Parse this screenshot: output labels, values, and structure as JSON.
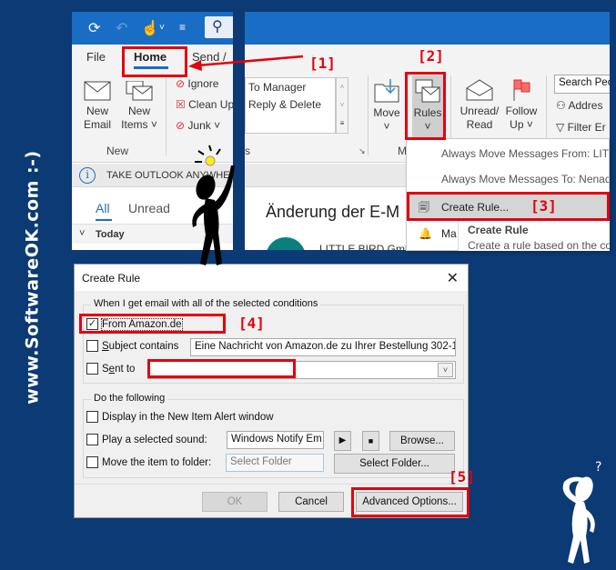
{
  "watermark": "www.SoftwareOK.com :-)",
  "outlook": {
    "tabs": {
      "file": "File",
      "home": "Home",
      "send": "Send /"
    },
    "new_group": {
      "new_email_l1": "New",
      "new_email_l2": "Email",
      "new_items_l1": "New",
      "new_items_l2": "Items ˅",
      "label": "New"
    },
    "delete_group": {
      "ignore": "Ignore",
      "clean_up": "Clean Up",
      "junk": "Junk ˅"
    },
    "quick_steps": {
      "item1": "To Manager",
      "item2": "Reply & Delete",
      "label": "s"
    },
    "move_group": {
      "move": "Move",
      "move_arrow": "˅",
      "rules": "Rules",
      "rules_arrow": "˅",
      "label": "Mo"
    },
    "tags_group": {
      "unread_l1": "Unread/",
      "unread_l2": "Read",
      "follow_l1": "Follow",
      "follow_l2": "Up ˅"
    },
    "find_group": {
      "search_people": "Search Peo",
      "address_book": "Addres",
      "filter_email": "Filter Er"
    },
    "infobar": "TAKE OUTLOOK ANYWHE",
    "mail_tabs": {
      "all": "All",
      "unread": "Unread"
    },
    "list_group": "Today",
    "reading_subject": "Änderung der E-M",
    "reading_sender": "LITTLE BIRD GmbH <n"
  },
  "rules_menu": {
    "items": [
      "Always Move Messages From: LITTLE",
      "Always Move Messages To: Nenad",
      "Create Rule...",
      "Ma"
    ],
    "tooltip_title": "Create Rule",
    "tooltip_text": "Create a rule based on the con"
  },
  "annotations": [
    "[1]",
    "[2]",
    "[3]",
    "[4]",
    "[5]"
  ],
  "dialog": {
    "title": "Create Rule",
    "conditions_legend": "When I get email with all of the selected conditions",
    "from": {
      "label": "From Amazon.de",
      "checked": true
    },
    "subject": {
      "label": "Subject contains",
      "checked": false,
      "value": "Eine Nachricht von Amazon.de zu Ihrer Bestellung 302-1"
    },
    "sent_to": {
      "label": "Sent to",
      "checked": false,
      "value": ""
    },
    "actions_legend": "Do the following",
    "display_alert": {
      "label": "Display in the New Item Alert window",
      "checked": false
    },
    "play_sound": {
      "label": "Play a selected sound:",
      "checked": false,
      "value": "Windows Notify Em",
      "browse": "Browse..."
    },
    "move_folder": {
      "label": "Move the item to folder:",
      "checked": false,
      "placeholder": "Select Folder",
      "button": "Select Folder..."
    },
    "buttons": {
      "ok": "OK",
      "cancel": "Cancel",
      "advanced": "Advanced Options..."
    }
  }
}
